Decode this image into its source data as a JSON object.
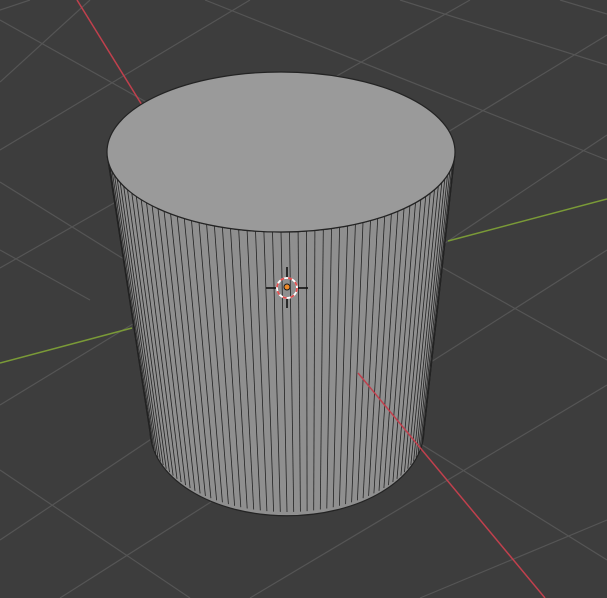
{
  "viewport": {
    "view": "3D Viewport",
    "shading": "solid",
    "background_color": "#3d3d3d",
    "grid_color": "#555555",
    "x_axis_color": "#c0404d",
    "y_axis_color": "#7a9a37"
  },
  "object": {
    "type": "cylinder",
    "wireframe_edges_visible": true,
    "top_color": "#9a9a9a",
    "side_color": "#8f8f8f",
    "edge_color": "#232323"
  },
  "cursor": {
    "icon": "3d-cursor-icon",
    "ring_colors": [
      "#e34d4d",
      "#ffffff"
    ]
  },
  "origin": {
    "icon": "object-origin-icon",
    "color": "#ee8a2a"
  }
}
